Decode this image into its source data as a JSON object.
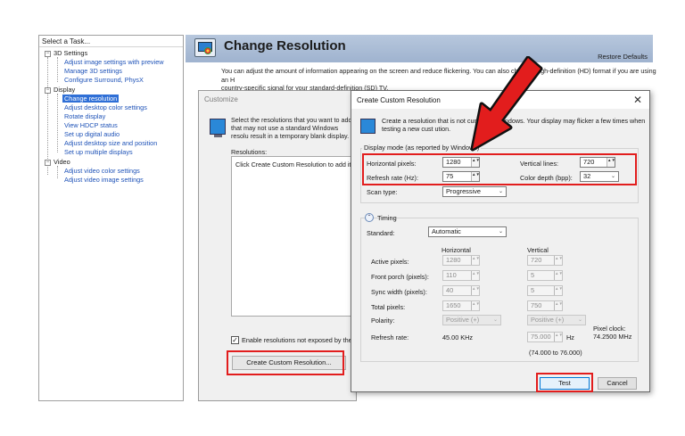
{
  "task_panel": {
    "header": "Select a Task...",
    "groups": [
      {
        "label": "3D Settings",
        "items": [
          "Adjust image settings with preview",
          "Manage 3D settings",
          "Configure Surround, PhysX"
        ]
      },
      {
        "label": "Display",
        "items": [
          "Change resolution",
          "Adjust desktop color settings",
          "Rotate display",
          "View HDCP status",
          "Set up digital audio",
          "Adjust desktop size and position",
          "Set up multiple displays"
        ]
      },
      {
        "label": "Video",
        "items": [
          "Adjust video color settings",
          "Adjust video image settings"
        ]
      }
    ],
    "toggle_symbol": "−",
    "selected_item": "Change resolution"
  },
  "main": {
    "title": "Change Resolution",
    "restore_defaults": "Restore Defaults",
    "intro_line1": "You can adjust the amount of information appearing on the screen and reduce flickering. You can also choo",
    "intro_line1b": "the high-definition (HD) format if you are using an H",
    "intro_line2": "country-specific signal for your standard-definition (SD) TV."
  },
  "customize": {
    "title": "Customize",
    "desc": "Select the resolutions that you want to add. that may not use a standard Windows resolu result in a temporary blank display.",
    "resolutions_label": "Resolutions:",
    "list_text": "Click Create Custom Resolution to add item",
    "enable_label": "Enable resolutions not exposed by the d",
    "enable_checked": "✓",
    "create_button": "Create Custom Resolution..."
  },
  "dialog": {
    "title": "Create Custom Resolution",
    "close": "✕",
    "desc": "Create a resolution that is not curr            ble in Windows. Your display may flicker a few times when testing a new cust          ution.",
    "display_mode_title": "Display mode (as reported by Windows)",
    "horizontal_pixels_label": "Horizontal pixels:",
    "horizontal_pixels": "1280",
    "vertical_lines_label": "Vertical lines:",
    "vertical_lines": "720",
    "refresh_rate_label": "Refresh rate (Hz):",
    "refresh_rate": "75",
    "color_depth_label": "Color depth (bpp):",
    "color_depth": "32",
    "scan_type_label": "Scan type:",
    "scan_type": "Progressive",
    "timing_label": "Timing",
    "timing_toggle": "⌃",
    "standard_label": "Standard:",
    "standard": "Automatic",
    "col_horizontal": "Horizontal",
    "col_vertical": "Vertical",
    "rows": [
      {
        "label": "Active pixels:",
        "h": "1280",
        "v": "720"
      },
      {
        "label": "Front porch (pixels):",
        "h": "110",
        "v": "5"
      },
      {
        "label": "Sync width (pixels):",
        "h": "40",
        "v": "5"
      },
      {
        "label": "Total pixels:",
        "h": "1650",
        "v": "750"
      }
    ],
    "polarity_label": "Polarity:",
    "polarity_h": "Positive (+)",
    "polarity_v": "Positive (+)",
    "refresh_rate2_label": "Refresh rate:",
    "refresh_h": "45.00 KHz",
    "refresh_v": "75.000",
    "hz_unit": "Hz",
    "refresh_range": "(74.000 to 76.000)",
    "pixel_clock_label": "Pixel clock:",
    "pixel_clock": "74.2500 MHz",
    "test_button": "Test",
    "cancel_button": "Cancel"
  },
  "glyphs": {
    "spin": "▲▼",
    "caret": "⌄"
  },
  "colors": {
    "annotation_red": "#e21d1d",
    "selected_blue": "#2f6fd6",
    "header_blue": "#9fb3cf"
  }
}
